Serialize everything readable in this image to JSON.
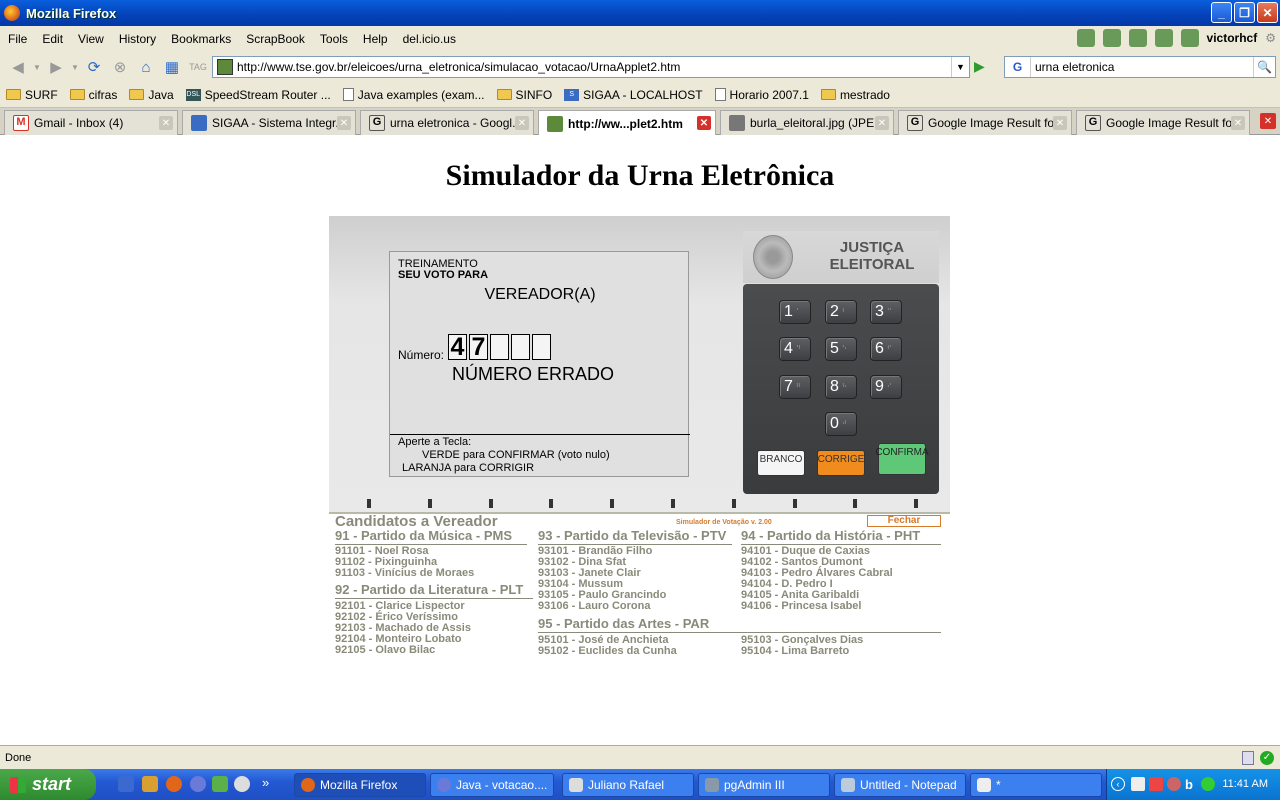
{
  "window": {
    "title": "Mozilla Firefox"
  },
  "menu": {
    "items": [
      "File",
      "Edit",
      "View",
      "History",
      "Bookmarks",
      "ScrapBook",
      "Tools",
      "Help",
      "del.icio.us"
    ],
    "user": "victorhcf"
  },
  "nav": {
    "url": "http://www.tse.gov.br/eleicoes/urna_eletronica/simulacao_votacao/UrnaApplet2.htm",
    "search_value": "urna eletronica"
  },
  "bookmarks": [
    {
      "label": "SURF",
      "icon": "folder-icon"
    },
    {
      "label": "cifras",
      "icon": "folder-icon"
    },
    {
      "label": "Java",
      "icon": "folder-icon"
    },
    {
      "label": "SpeedStream Router ...",
      "icon": "dsl-icon"
    },
    {
      "label": "Java examples (exam...",
      "icon": "page-icon"
    },
    {
      "label": "SINFO",
      "icon": "folder-icon"
    },
    {
      "label": "SIGAA - LOCALHOST",
      "icon": "sigaa-icon"
    },
    {
      "label": "Horario 2007.1",
      "icon": "page-icon"
    },
    {
      "label": "mestrado",
      "icon": "folder-icon"
    }
  ],
  "tabs": [
    {
      "label": "Gmail - Inbox (4)",
      "active": false,
      "color": "#d93025"
    },
    {
      "label": "SIGAA - Sistema Integr...",
      "active": false,
      "color": "#3b6cc4"
    },
    {
      "label": "urna eletronica - Googl...",
      "active": false,
      "color": "#555555"
    },
    {
      "label": "http://ww...plet2.htm",
      "active": true,
      "color": "#5d8a3a"
    },
    {
      "label": "burla_eleitoral.jpg (JPE...",
      "active": false,
      "color": "#777777"
    },
    {
      "label": "Google Image Result fo...",
      "active": false,
      "color": "#555555"
    },
    {
      "label": "Google Image Result fo...",
      "active": false,
      "color": "#555555"
    }
  ],
  "page": {
    "title": "Simulador da Urna Eletrônica"
  },
  "urna": {
    "screen": {
      "line1": "TREINAMENTO",
      "line2": "SEU VOTO PARA",
      "office": "VEREADOR(A)",
      "number_label": "Número:",
      "digits": [
        "4",
        "7",
        "",
        "",
        ""
      ],
      "error": "NÚMERO ERRADO",
      "help1": "Aperte a Tecla:",
      "help2": "VERDE para CONFIRMAR (voto nulo)",
      "help3": "LARANJA para CORRIGIR"
    },
    "brand": {
      "line1": "JUSTIÇA",
      "line2": "ELEITORAL"
    },
    "keys": [
      "1",
      "2",
      "3",
      "4",
      "5",
      "6",
      "7",
      "8",
      "9",
      "0"
    ],
    "branco": "BRANCO",
    "corrige": "CORRIGE",
    "confirma": "CONFIRMA"
  },
  "candidates": {
    "title": "Candidatos a Vereador",
    "version": "Simulador de Votação v. 2.00",
    "close": "Fechar",
    "parties": [
      {
        "name": "91 - Partido da Música - PMS",
        "list": [
          "91101 - Noel Rosa",
          "91102 - Pixinguinha",
          "91103 - Vinícius de Moraes"
        ]
      },
      {
        "name": "92 - Partido da Literatura - PLT",
        "list": [
          "92101 - Clarice Lispector",
          "92102 - Érico Veríssimo",
          "92103 - Machado de Assis",
          "92104 - Monteiro Lobato",
          "92105 - Olavo Bilac"
        ]
      },
      {
        "name": "93 - Partido da Televisão - PTV",
        "list": [
          "93101 - Brandão Filho",
          "93102 - Dina Sfat",
          "93103 - Janete Clair",
          "93104 - Mussum",
          "93105 - Paulo Grancindo",
          "93106 - Lauro Corona"
        ]
      },
      {
        "name": "94 - Partido da História - PHT",
        "list": [
          "94101 - Duque de Caxias",
          "94102 - Santos Dumont",
          "94103 - Pedro Álvares Cabral",
          "94104 - D. Pedro I",
          "94105 - Anita Garibaldi",
          "94106 - Princesa Isabel"
        ]
      },
      {
        "name": "95 - Partido das Artes - PAR",
        "list_a": [
          "95101 - José de Anchieta",
          "95102 - Euclides da Cunha"
        ],
        "list_b": [
          "95103 - Gonçalves Dias",
          "95104 - Lima Barreto"
        ]
      }
    ]
  },
  "status": {
    "text": "Done"
  },
  "taskbar": {
    "start": "start",
    "tasks": [
      {
        "label": "Mozilla Firefox",
        "active": true
      },
      {
        "label": "Java - votacao....",
        "active": false
      },
      {
        "label": "Juliano Rafael",
        "active": false
      },
      {
        "label": "pgAdmin III",
        "active": false
      },
      {
        "label": "Untitled - Notepad",
        "active": false
      },
      {
        "label": "*",
        "active": false
      }
    ],
    "clock": "11:41 AM"
  }
}
